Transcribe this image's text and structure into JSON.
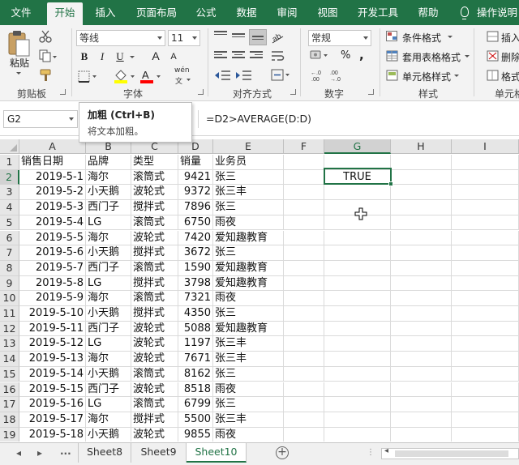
{
  "ribbon_tabs": [
    "文件",
    "开始",
    "插入",
    "页面布局",
    "公式",
    "数据",
    "审阅",
    "视图",
    "开发工具",
    "帮助",
    "操作说明"
  ],
  "active_tab": "开始",
  "clipboard": {
    "paste": "粘贴",
    "label": "剪贴板"
  },
  "font": {
    "name": "等线",
    "size": "11",
    "bold": "B",
    "italic": "I",
    "underline": "U",
    "grow": "A",
    "shrink": "A",
    "wen": "wén",
    "label": "字体"
  },
  "alignment": {
    "label": "对齐方式"
  },
  "number": {
    "format": "常规",
    "percent": "%",
    "comma": ",",
    "label": "数字"
  },
  "styles": {
    "conditional": "条件格式",
    "table": "套用表格格式",
    "cell": "单元格样式",
    "label": "样式"
  },
  "cells": {
    "insert": "插入",
    "delete": "删除",
    "format": "格式",
    "label": "单元格"
  },
  "tooltip": {
    "title": "加粗 (Ctrl+B)",
    "desc": "将文本加粗。"
  },
  "name_box": "G2",
  "formula": "=D2>AVERAGE(D:D)",
  "columns": [
    "A",
    "B",
    "C",
    "D",
    "E",
    "F",
    "G",
    "H",
    "I"
  ],
  "selected_column": "G",
  "selected_row": "2",
  "rows": [
    {
      "n": "1",
      "a": "销售日期",
      "b": "品牌",
      "c": "类型",
      "d": "销量",
      "e": "业务员"
    },
    {
      "n": "2",
      "a": "2019-5-1",
      "b": "海尔",
      "c": "滚筒式",
      "d": "9421",
      "e": "张三",
      "g": "TRUE"
    },
    {
      "n": "3",
      "a": "2019-5-2",
      "b": "小天鹅",
      "c": "波轮式",
      "d": "9372",
      "e": "张三丰"
    },
    {
      "n": "4",
      "a": "2019-5-3",
      "b": "西门子",
      "c": "搅拌式",
      "d": "7896",
      "e": "张三"
    },
    {
      "n": "5",
      "a": "2019-5-4",
      "b": "LG",
      "c": "滚筒式",
      "d": "6750",
      "e": "雨夜"
    },
    {
      "n": "6",
      "a": "2019-5-5",
      "b": "海尔",
      "c": "波轮式",
      "d": "7420",
      "e": "爱知趣教育"
    },
    {
      "n": "7",
      "a": "2019-5-6",
      "b": "小天鹅",
      "c": "搅拌式",
      "d": "3672",
      "e": "张三"
    },
    {
      "n": "8",
      "a": "2019-5-7",
      "b": "西门子",
      "c": "滚筒式",
      "d": "1590",
      "e": "爱知趣教育"
    },
    {
      "n": "9",
      "a": "2019-5-8",
      "b": "LG",
      "c": "搅拌式",
      "d": "3798",
      "e": "爱知趣教育"
    },
    {
      "n": "10",
      "a": "2019-5-9",
      "b": "海尔",
      "c": "滚筒式",
      "d": "7321",
      "e": "雨夜"
    },
    {
      "n": "11",
      "a": "2019-5-10",
      "b": "小天鹅",
      "c": "搅拌式",
      "d": "4350",
      "e": "张三"
    },
    {
      "n": "12",
      "a": "2019-5-11",
      "b": "西门子",
      "c": "波轮式",
      "d": "5088",
      "e": "爱知趣教育"
    },
    {
      "n": "13",
      "a": "2019-5-12",
      "b": "LG",
      "c": "波轮式",
      "d": "1197",
      "e": "张三丰"
    },
    {
      "n": "14",
      "a": "2019-5-13",
      "b": "海尔",
      "c": "波轮式",
      "d": "7671",
      "e": "张三丰"
    },
    {
      "n": "15",
      "a": "2019-5-14",
      "b": "小天鹅",
      "c": "滚筒式",
      "d": "8162",
      "e": "张三"
    },
    {
      "n": "16",
      "a": "2019-5-15",
      "b": "西门子",
      "c": "波轮式",
      "d": "8518",
      "e": "雨夜"
    },
    {
      "n": "17",
      "a": "2019-5-16",
      "b": "LG",
      "c": "滚筒式",
      "d": "6799",
      "e": "张三"
    },
    {
      "n": "18",
      "a": "2019-5-17",
      "b": "海尔",
      "c": "搅拌式",
      "d": "5500",
      "e": "张三丰"
    },
    {
      "n": "19",
      "a": "2019-5-18",
      "b": "小天鹅",
      "c": "波轮式",
      "d": "9855",
      "e": "雨夜"
    }
  ],
  "sheet_nav": {
    "ellipsis": "...",
    "add": "+"
  },
  "sheet_tabs": [
    "Sheet8",
    "Sheet9",
    "Sheet10"
  ],
  "active_sheet": "Sheet10",
  "colors": {
    "excel_green": "#217346",
    "ribbon_bg": "#f3f3f3"
  }
}
